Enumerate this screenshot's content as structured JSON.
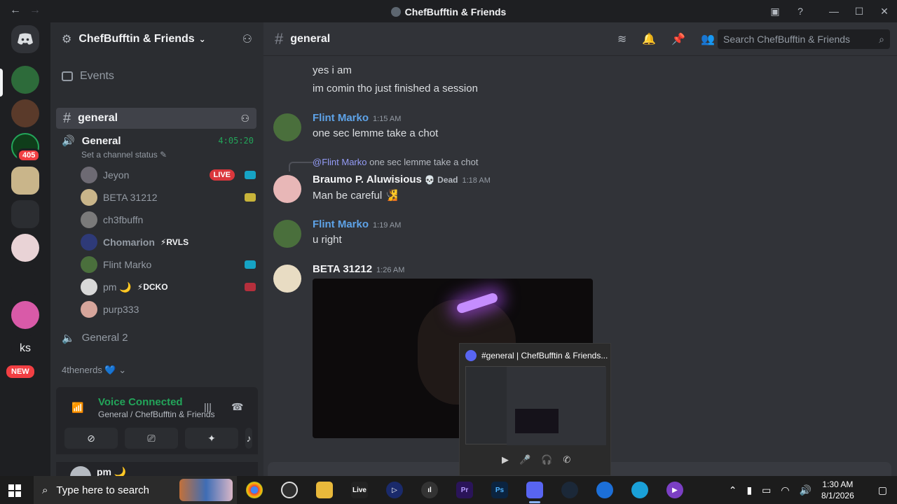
{
  "window": {
    "title": "ChefBufftin & Friends",
    "back": "←",
    "forward": "→"
  },
  "rail": {
    "badge_count": "405",
    "new_label": "NEW",
    "ks_label": "ks"
  },
  "sidebar": {
    "server_name": "ChefBufftin & Friends",
    "events_label": "Events",
    "selected_channel": "general",
    "voice_channel": {
      "name": "General",
      "timer": "4:05:20",
      "status_placeholder": "Set a channel status"
    },
    "voice_users": [
      {
        "name": "Jeyon",
        "tag": "",
        "live": "LIVE",
        "color": "#6d6a73"
      },
      {
        "name": "BETA 31212",
        "tag": "",
        "live": "",
        "color": "#c9b58a"
      },
      {
        "name": "ch3fbuffn",
        "tag": "",
        "live": "",
        "color": "#7a7a7a"
      },
      {
        "name": "Chomarion",
        "tag": "⚡RVLS",
        "live": "",
        "color": "#2e3a78"
      },
      {
        "name": "Flint Marko",
        "tag": "",
        "live": "",
        "color": "#4a6f3c"
      },
      {
        "name": "pm 🌙",
        "tag": "⚡DCKO",
        "live": "",
        "color": "#d8d8d8"
      },
      {
        "name": "purp333",
        "tag": "",
        "live": "",
        "color": "#d6a59b"
      }
    ],
    "general2": "General 2",
    "category": "4thenerds 💙"
  },
  "voice_panel": {
    "title": "Voice Connected",
    "subtitle": "General / ChefBufftin & Friends"
  },
  "user_bar": {
    "name": "pm 🌙"
  },
  "chat": {
    "channel": "general",
    "search_placeholder": "Search ChefBufftin & Friends",
    "continuation": [
      "yes i am",
      "im comin tho just finished a session"
    ],
    "messages": [
      {
        "author": "Flint Marko",
        "time": "1:15 AM",
        "text": "one sec lemme take a chot",
        "color": "#5ea3e8"
      },
      {
        "author": "Braumo P. Aluwisious",
        "time": "1:18 AM",
        "text": "Man be careful 🧏",
        "color": "#f2f3f5",
        "tag": "💀 Dead"
      },
      {
        "author": "Flint Marko",
        "time": "1:19 AM",
        "text": "u right",
        "color": "#5ea3e8"
      },
      {
        "author": "BETA 31212",
        "time": "1:26 AM",
        "text": "",
        "color": "#f2f3f5"
      }
    ],
    "reply": {
      "mention": "@Flint Marko",
      "text": "one sec lemme take a chot"
    }
  },
  "preview": {
    "title": "#general | ChefBufftin & Friends..."
  },
  "taskbar": {
    "search_placeholder": "Type here to search",
    "time": "1:30 AM",
    "date": "8/1/2026",
    "apps": [
      "chrome",
      "obs",
      "files",
      "live",
      "video",
      "audio",
      "premiere",
      "photoshop",
      "discord",
      "steam",
      "app-blue",
      "dolphin",
      "media-player"
    ]
  }
}
